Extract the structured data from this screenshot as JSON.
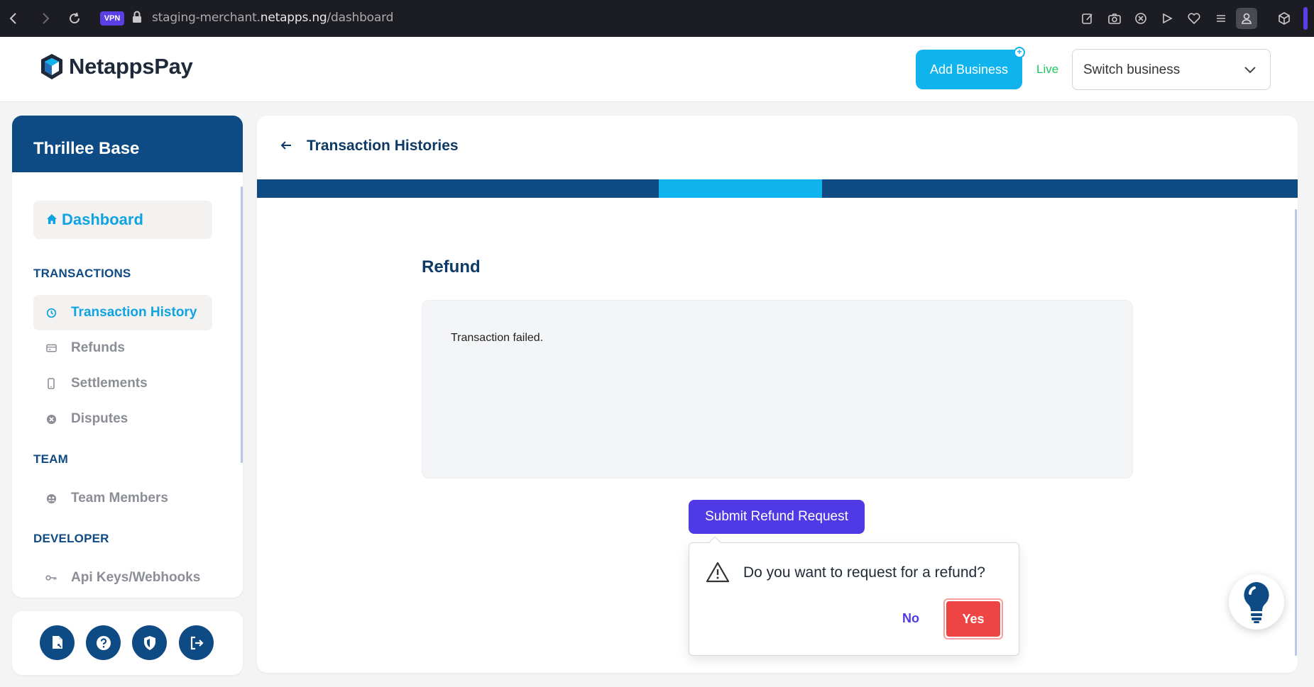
{
  "browser": {
    "vpn_label": "VPN",
    "url_prefix": "staging-merchant.",
    "url_domain": "netapps.ng",
    "url_path": "/dashboard"
  },
  "header": {
    "logo_text": "NetappsPay",
    "add_business_label": "Add Business",
    "mode_label": "Live",
    "switch_business_placeholder": "Switch business"
  },
  "sidebar": {
    "business_name": "Thrillee Base",
    "dashboard_label": "Dashboard",
    "sections": {
      "transactions": "TRANSACTIONS",
      "team": "TEAM",
      "developer": "DEVELOPER"
    },
    "items": [
      {
        "label": "Transaction History",
        "icon": "history-icon"
      },
      {
        "label": "Refunds",
        "icon": "card-icon"
      },
      {
        "label": "Settlements",
        "icon": "phone-icon"
      },
      {
        "label": "Disputes",
        "icon": "x-circle-icon"
      },
      {
        "label": "Team Members",
        "icon": "team-icon"
      },
      {
        "label": "Api Keys/Webhooks",
        "icon": "key-icon"
      }
    ],
    "bottom_icons": [
      "document-icon",
      "help-icon",
      "shield-icon",
      "logout-icon"
    ]
  },
  "main": {
    "page_title": "Transaction Histories",
    "refund_heading": "Refund",
    "reason_text": "Transaction failed.",
    "submit_label": "Submit Refund Request"
  },
  "popconfirm": {
    "message": "Do you want to request for a refund?",
    "no_label": "No",
    "yes_label": "Yes"
  },
  "colors": {
    "navy": "#0e4a83",
    "cyan": "#0fb3ee",
    "purple": "#4f3ae6",
    "danger": "#ef4444",
    "live": "#22c55e"
  }
}
